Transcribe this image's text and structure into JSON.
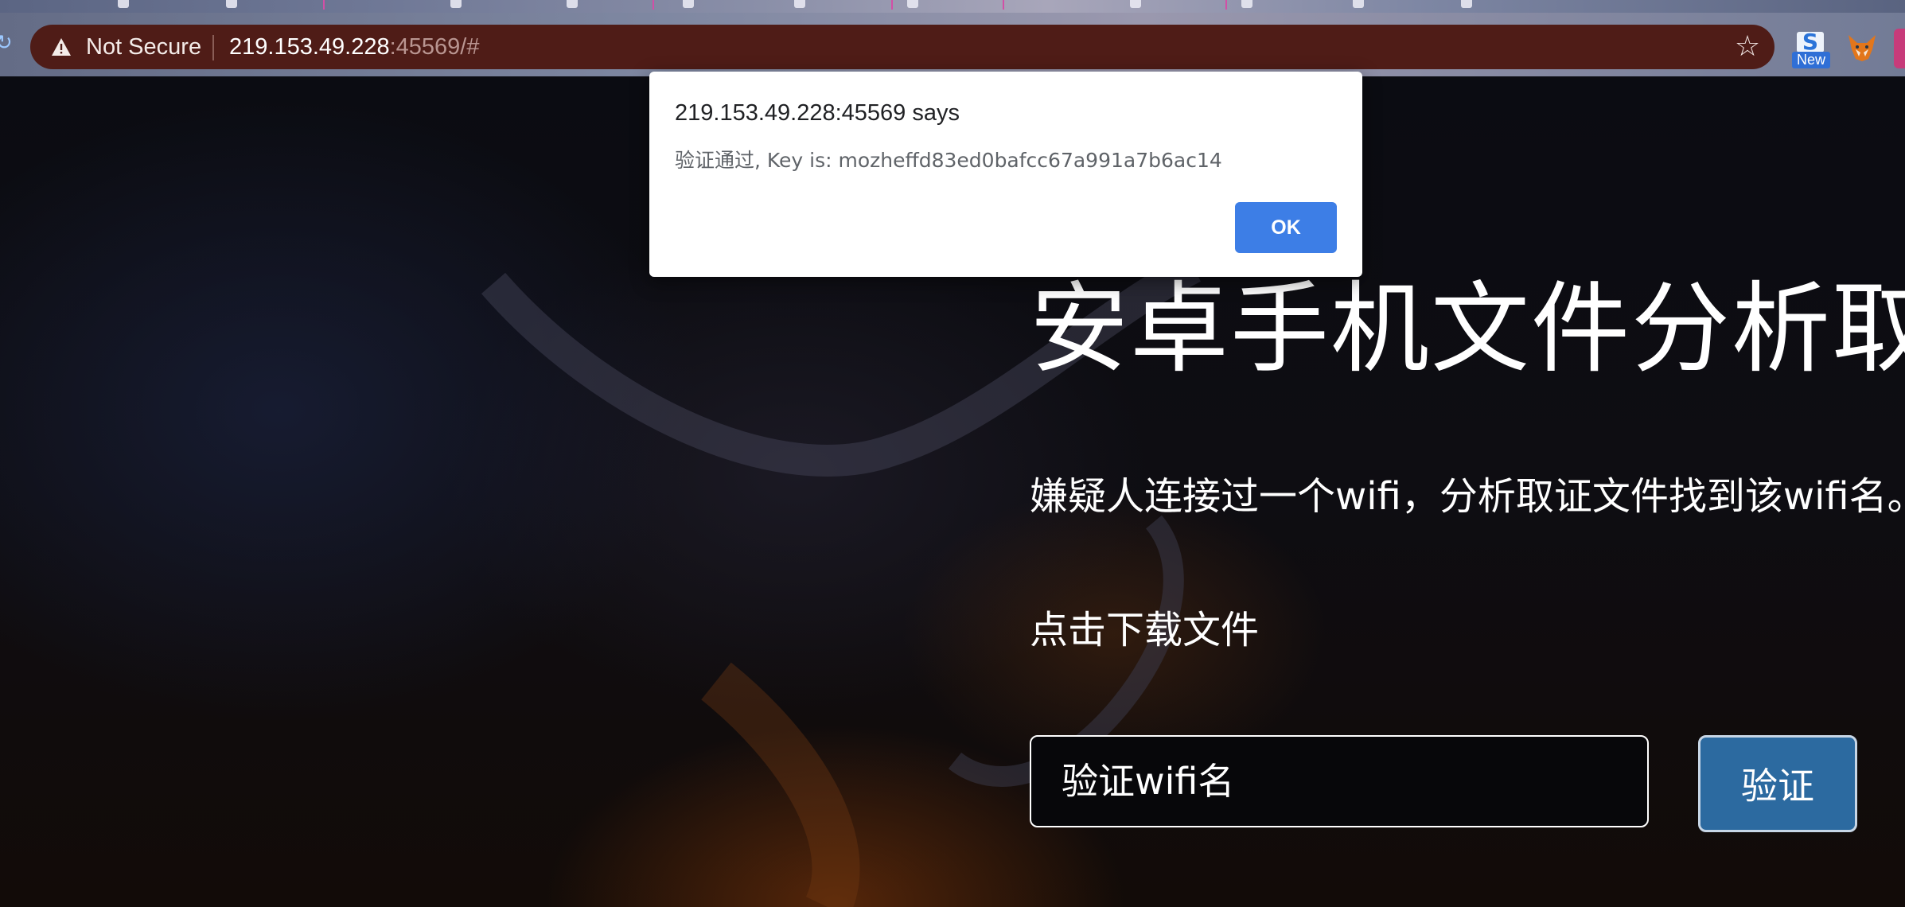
{
  "browser": {
    "security_label": "Not Secure",
    "url_host": "219.153.49.228",
    "url_rest": ":45569/#",
    "extension_badge": "New",
    "extension_letter": "S",
    "icons": [
      "reload-icon",
      "warning-icon",
      "star-icon",
      "new-badge-extension-icon",
      "fox-extension-icon"
    ]
  },
  "page": {
    "title": "安卓手机文件分析取",
    "description": "嫌疑人连接过一个wifi，分析取证文件找到该wifi名。",
    "download_link": "点击下载文件",
    "input_placeholder": "验证wifi名",
    "verify_button": "验证",
    "colors": {
      "verify_button": "#2c6aa0",
      "text": "#ffffff"
    }
  },
  "alert": {
    "origin": "219.153.49.228:45569 says",
    "message": "验证通过, Key is: mozheffd83ed0bafcc67a991a7b6ac14",
    "ok_label": "OK",
    "colors": {
      "ok_button": "#3d7ee6"
    }
  }
}
